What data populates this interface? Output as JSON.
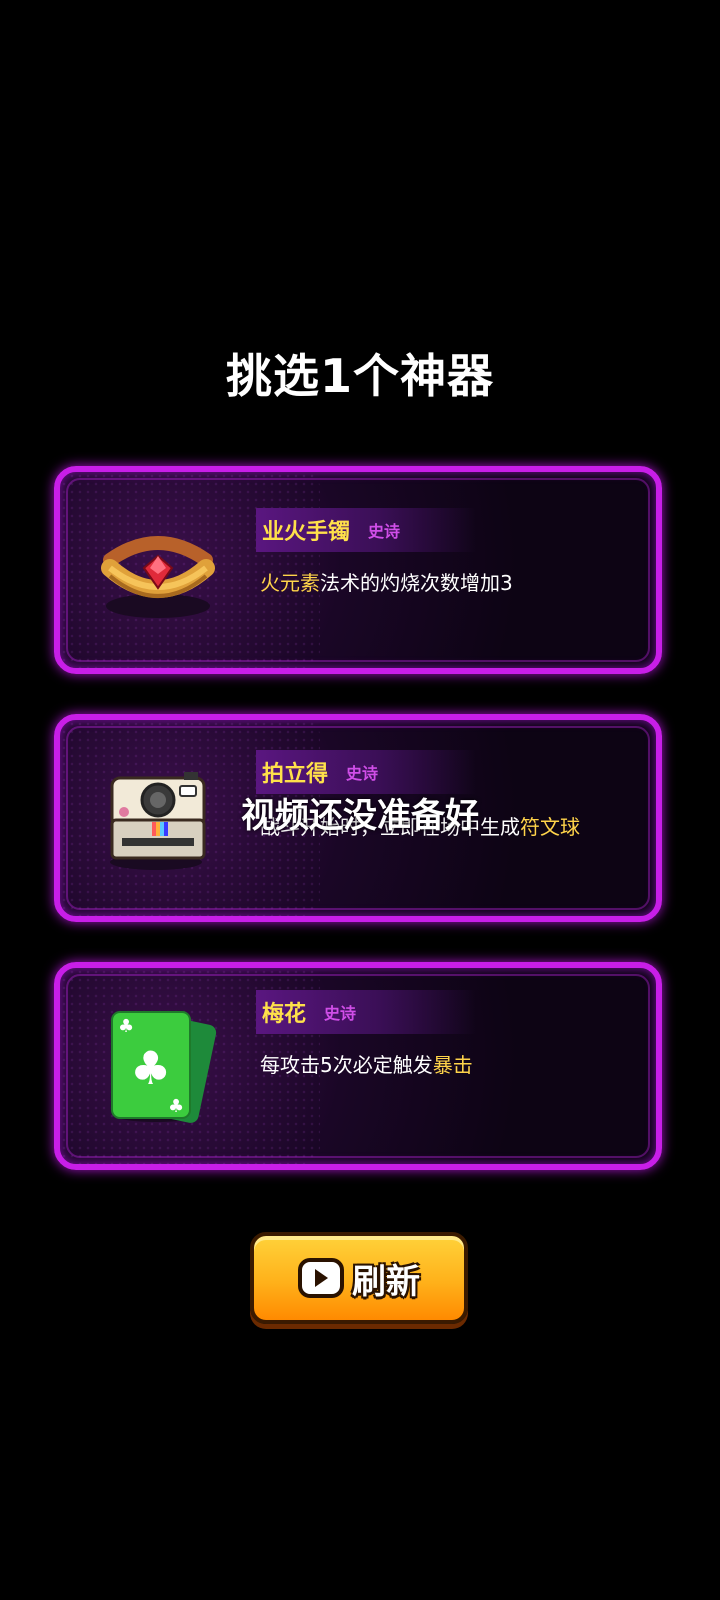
{
  "title": "挑选1个神器",
  "cards": [
    {
      "name": "业火手镯",
      "rarity": "史诗",
      "icon": "bracelet-icon",
      "desc_parts": [
        {
          "text": "火元素",
          "highlight": true
        },
        {
          "text": "法术的灼烧次数增加3",
          "highlight": false
        }
      ]
    },
    {
      "name": "拍立得",
      "rarity": "史诗",
      "icon": "instant-camera-icon",
      "desc_parts": [
        {
          "text": "战斗开始时，立即在场中生成",
          "highlight": false
        },
        {
          "text": "符文球",
          "highlight": true
        }
      ]
    },
    {
      "name": "梅花",
      "rarity": "史诗",
      "icon": "club-card-icon",
      "desc_parts": [
        {
          "text": "每攻击5次必定触发",
          "highlight": false
        },
        {
          "text": "暴击",
          "highlight": true
        }
      ]
    }
  ],
  "overlay_message": "视频还没准备好",
  "refresh_button": {
    "label": "刷新",
    "icon": "video-play-icon"
  },
  "colors": {
    "accent_border": "#c81ee8",
    "name": "#ffe14a",
    "rarity": "#d04ee8",
    "highlight": "#ffd44a",
    "button": "#ffb11a"
  }
}
